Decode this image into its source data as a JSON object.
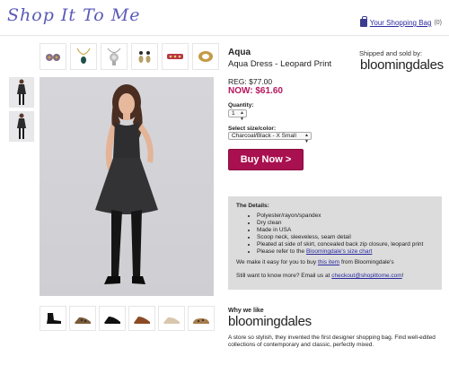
{
  "header": {
    "logo_text": "Shop It To Me",
    "bag_label": "Your Shopping Bag",
    "bag_count": "(0)"
  },
  "product": {
    "brand": "Aqua",
    "name": "Aqua Dress - Leopard Print",
    "reg_price": "REG: $77.00",
    "now_price": "NOW: $61.60",
    "quantity_label": "Quantity:",
    "quantity_value": "1",
    "size_label": "Select size/color:",
    "size_value": "Charcoal/Black - X Small",
    "buy_label": "Buy Now >"
  },
  "seller": {
    "shipped_label": "Shipped and sold by:",
    "store_logo_text": "bloomingdales"
  },
  "details": {
    "title": "The Details:",
    "items": [
      "Polyester/rayon/spandex",
      "Dry clean",
      "Made in USA",
      "Scoop neck, sleeveless, seam detail",
      "Pleated at side of skirt, concealed back zip closure, leopard print"
    ],
    "size_chart_prefix": "Please refer to the",
    "size_chart_link": "Bloomingdale's size chart",
    "easy_prefix": "We make it easy for you to buy",
    "easy_link": "this item",
    "easy_suffix": "from Bloomingdale's",
    "more_prefix": "Still want to know more? Email us at",
    "more_email": "checkout@shopittome.com",
    "more_suffix": "!"
  },
  "why": {
    "heading": "Why we like",
    "store_logo_text": "bloomingdales",
    "description": "A store so stylish, they invented the first designer shopping bag. Find well-edited collections of contemporary and classic, perfectly mixed."
  },
  "colors": {
    "accent": "#a8104f",
    "now_price": "#b8175c",
    "link": "#2a2aa0",
    "details_bg": "#dcdcdc"
  }
}
